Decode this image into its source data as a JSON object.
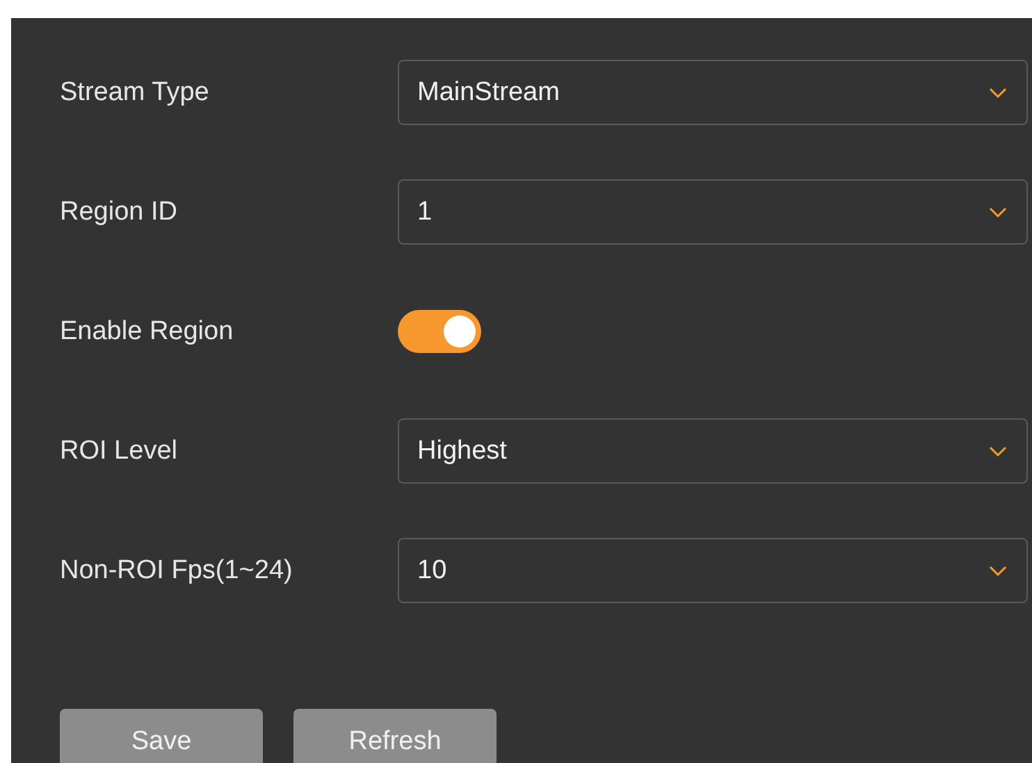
{
  "fields": [
    {
      "kind": "select",
      "label": "Stream Type",
      "value": "MainStream"
    },
    {
      "kind": "select",
      "label": "Region ID",
      "value": "1"
    },
    {
      "kind": "toggle",
      "label": "Enable Region",
      "on": true
    },
    {
      "kind": "select",
      "label": "ROI Level",
      "value": "Highest"
    },
    {
      "kind": "select",
      "label": "Non-ROI Fps(1~24)",
      "value": "10"
    }
  ],
  "buttons": [
    "Save",
    "Refresh"
  ]
}
